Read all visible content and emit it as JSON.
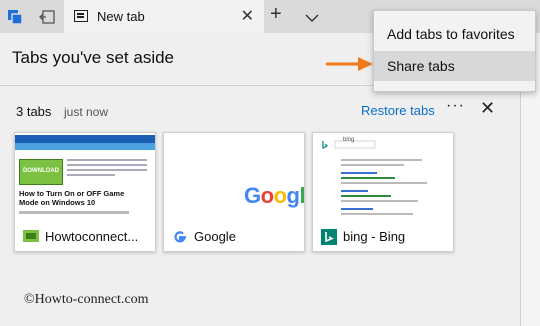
{
  "tabstrip": {
    "active_tab_title": "New tab"
  },
  "panel": {
    "title": "Tabs you've set aside",
    "set": {
      "count": "3 tabs",
      "time": "just now",
      "restore_label": "Restore tabs",
      "more_label": "···",
      "close_label": "✕"
    },
    "cards": [
      {
        "title": "Howtoconnect...",
        "thumb_headline": "How to Turn On or OFF Game Mode on Windows 10",
        "thumb_badge": "DOWNLOAD"
      },
      {
        "title": "Google",
        "thumb_logo": "Google"
      },
      {
        "title": "bing - Bing",
        "thumb_search": "bing"
      }
    ]
  },
  "menu": {
    "items": [
      {
        "label": "Add tabs to favorites"
      },
      {
        "label": "Share tabs"
      }
    ]
  },
  "watermark": "©Howto-connect.com",
  "colors": {
    "accent": "#0a6cc9",
    "arrow": "#f07a1a",
    "edge_blue": "#1e6fd9"
  }
}
